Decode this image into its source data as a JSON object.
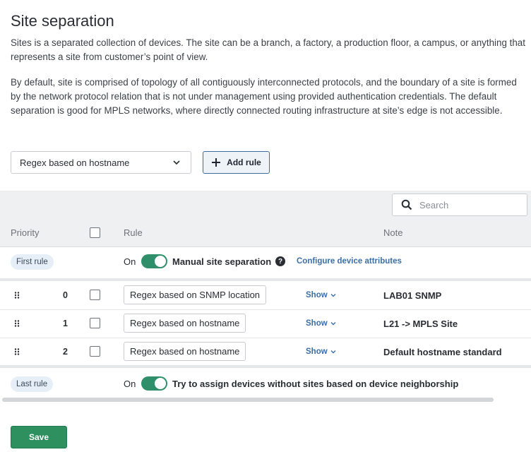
{
  "page": {
    "title": "Site separation",
    "paragraph1": "Sites is a separated collection of devices. The site can be a branch, a factory, a production floor, a campus, or anything that represents a site from customer’s point of view.",
    "paragraph2": "By default, site is comprised of topology of all contiguously interconnected protocols, and the boundary of a site is formed by the network protocol relation that is not under management using provided authentication credentials. The default separation is good for MPLS networks, where directly connected routing infrastructure at site’s edge is not accessible."
  },
  "controls": {
    "rule_type_selected": "Regex based on hostname",
    "add_rule_label": "Add rule",
    "search_placeholder": "Search"
  },
  "table": {
    "headers": {
      "priority": "Priority",
      "rule": "Rule",
      "note": "Note"
    },
    "first_rule": {
      "badge": "First rule",
      "toggle_label": "On",
      "toggle_on": true,
      "text": "Manual site separation",
      "help": "?",
      "link": "Configure device attributes"
    },
    "rows": [
      {
        "priority": "0",
        "rule": "Regex based on SNMP location",
        "show": "Show",
        "note": "LAB01 SNMP"
      },
      {
        "priority": "1",
        "rule": "Regex based on hostname",
        "show": "Show",
        "note": "L21 -> MPLS Site"
      },
      {
        "priority": "2",
        "rule": "Regex based on hostname",
        "show": "Show",
        "note": "Default hostname standard"
      }
    ],
    "last_rule": {
      "badge": "Last rule",
      "toggle_label": "On",
      "toggle_on": true,
      "text": "Try to assign devices without sites based on device neighborship"
    }
  },
  "footer": {
    "save_label": "Save"
  },
  "colors": {
    "accent_green": "#2e8f6a",
    "link_blue": "#3a6fa5",
    "badge_bg": "#e6eef7"
  }
}
